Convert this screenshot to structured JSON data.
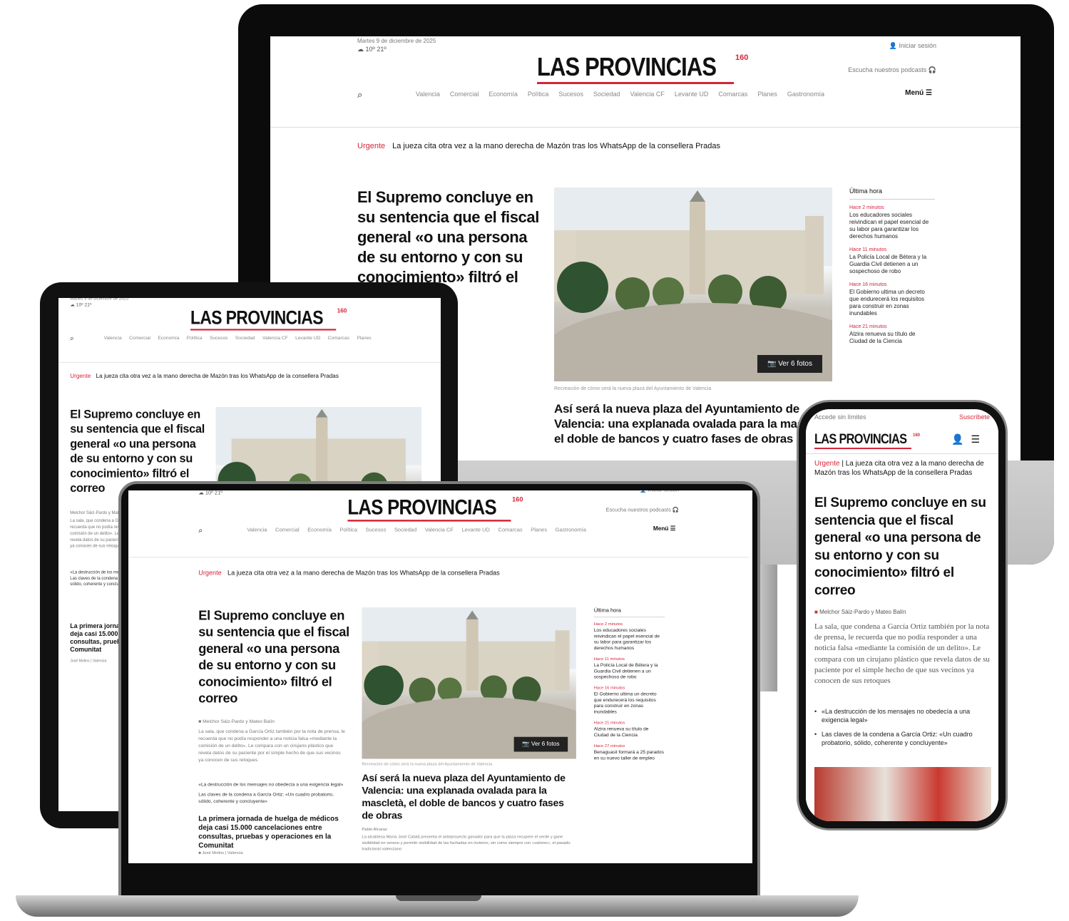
{
  "site": {
    "logo": "LAS PROVINCIAS",
    "logo_badge": "160",
    "date": "Martes 9 de diciembre de 2025",
    "weather": "10º  21º",
    "login": "Iniciar sesión",
    "podcast": "Escucha nuestros podcasts",
    "menu": "Menú ☰",
    "nav": [
      "Valencia",
      "Comercial",
      "Economía",
      "Política",
      "Sucesos",
      "Sociedad",
      "Valencia CF",
      "Levante UD",
      "Comarcas",
      "Planes",
      "Gastronomía"
    ]
  },
  "urgent": {
    "tag": "Urgente",
    "text": "La jueza cita otra vez a la mano derecha de Mazón tras los WhatsApp de la consellera Pradas"
  },
  "lead": {
    "headline": "El Supremo concluye en su sentencia que el fiscal general «o una persona de su entorno y con su conocimiento» filtró el correo",
    "byline": "Melchor Sáiz-Pardo y Mateo Balín",
    "body": "La sala, que condena a García Ortiz también por la nota de prensa, le recuerda que no podía responder a una noticia falsa «mediante la comisión de un delito». Le compara con un cirujano plástico que revela datos de su paciente por el simple hecho de que sus vecinos ya conocen de sus retoques",
    "bullets": [
      "«La destrucción de los mensajes no obedecía a una exigencia legal»",
      "Las claves de la condena a García Ortiz: «Un cuadro probatorio, sólido, coherente y concluyente»"
    ]
  },
  "second": {
    "headline": "La primera jornada de huelga de médicos deja casi 15.000 cancelaciones entre consultas, pruebas y operaciones en la Comunitat",
    "byline": "José Molins | Valencia"
  },
  "photo": {
    "button": "Ver 6 fotos",
    "caption": "Recreación de cómo será la nueva plaza del Ayuntamiento de Valencia"
  },
  "story": {
    "headline": "Así será la nueva plaza del Ayuntamiento de Valencia: una explanada ovalada para la mascletà, el doble de bancos y cuatro fases de obras",
    "byline": "Pablo Alcaraz",
    "body": "La alcaldesa María José Catalá presenta el anteproyecto ganador para que la plaza recupere el verde y gane visibilidad en verano y permitir visibilidad de las fachadas en invierno, sin como siempre con «valores», el pasado tradicional valenciano"
  },
  "latest": {
    "title": "Última hora",
    "items": [
      {
        "time": "Hace 2 minutos",
        "text": "Los educadores sociales reivindican el papel esencial de su labor para garantizar los derechos humanos"
      },
      {
        "time": "Hace 11 minutos",
        "text": "La Policía Local de Bétera y la Guardia Civil detienen a un sospechoso de robo"
      },
      {
        "time": "Hace 16 minutos",
        "text": "El Gobierno ultima un decreto que endurecerá los requisitos para construir en zonas inundables"
      },
      {
        "time": "Hace 21 minutos",
        "text": "Alzira renueva su título de Ciudad de la Ciencia"
      },
      {
        "time": "Hace 27 minutos",
        "text": "Benaguasil formará a 25 parados en su nuevo taller de empleo"
      }
    ]
  },
  "mobile": {
    "access": "Accede sin límites",
    "subscribe": "Suscríbete"
  },
  "colors": {
    "brand_red": "#d4253a",
    "frame_black": "#0b0b0b",
    "text_dark": "#111111"
  }
}
